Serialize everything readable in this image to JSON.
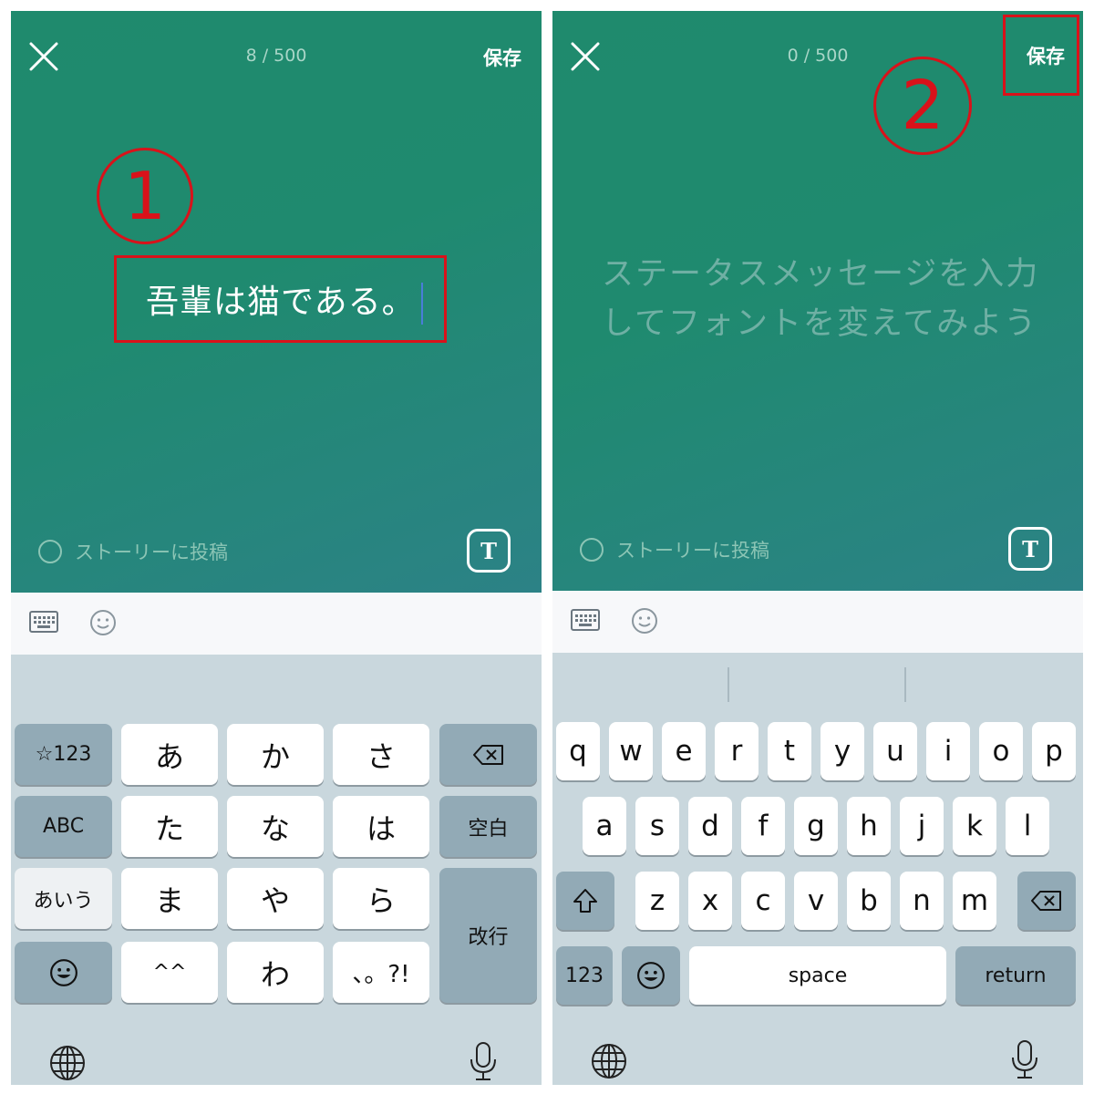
{
  "left": {
    "counter": "8 / 500",
    "save_label": "保存",
    "typed_text": "吾輩は猫である。",
    "story_label": "ストーリーに投稿",
    "font_button_label": "T",
    "annotation_number": "1",
    "keys": {
      "row1": [
        "☆123",
        "あ",
        "か",
        "さ"
      ],
      "row2": [
        "ABC",
        "た",
        "な",
        "は",
        "空白"
      ],
      "row3": [
        "あいう",
        "ま",
        "や",
        "ら"
      ],
      "row4": [
        "^^",
        "わ",
        "、。?!"
      ],
      "enter": "改行"
    }
  },
  "right": {
    "counter": "0 / 500",
    "save_label": "保存",
    "placeholder_line1": "ステータスメッセージを入力",
    "placeholder_line2": "してフォントを変えてみよう",
    "story_label": "ストーリーに投稿",
    "font_button_label": "T",
    "annotation_number": "2",
    "keys": {
      "row1": [
        "q",
        "w",
        "e",
        "r",
        "t",
        "y",
        "u",
        "i",
        "o",
        "p"
      ],
      "row2": [
        "a",
        "s",
        "d",
        "f",
        "g",
        "h",
        "j",
        "k",
        "l"
      ],
      "row3": [
        "z",
        "x",
        "c",
        "v",
        "b",
        "n",
        "m"
      ],
      "numbers": "123",
      "space": "space",
      "return": "return"
    }
  },
  "colors": {
    "editor_bg": "#1f8a6e",
    "annotation": "#d9121a",
    "keyboard_bg": "#c9d7dd",
    "dark_key": "#92aab6"
  },
  "icons": [
    "close-icon",
    "keyboard-icon",
    "emoji-icon",
    "backspace-icon",
    "shift-icon",
    "globe-icon",
    "microphone-icon"
  ]
}
